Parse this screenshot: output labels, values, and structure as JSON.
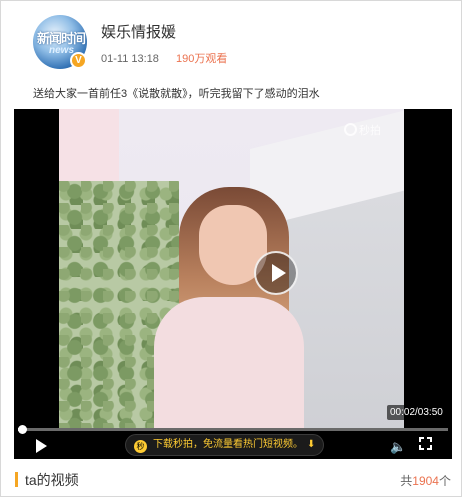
{
  "post": {
    "username": "娱乐情报媛",
    "time": "01-11 13:18",
    "views": "190万观看",
    "avatar_text_main": "新闻时间",
    "avatar_text_sub": "news",
    "verified_badge": "V",
    "description": "送给大家一首前任3《说散就散》，听完我留下了感动的泪水"
  },
  "player": {
    "watermark": "秒拍",
    "time_display": "00:02/03:50",
    "progress": 0.009,
    "promo_logo": "秒",
    "promo_text": "下载秒拍，免流量看热门短视频。",
    "promo_download_icon": "⬇",
    "volume_icon": "🔈",
    "icons": [
      "play-icon",
      "volume-icon",
      "fullscreen-icon",
      "download-icon"
    ]
  },
  "section": {
    "title": "ta的视频",
    "count_prefix": "共",
    "count_value": "1904",
    "count_suffix": "个"
  },
  "colors": {
    "accent": "#eb7350",
    "badge": "#f5a623",
    "promo_text": "#ffcc33"
  }
}
